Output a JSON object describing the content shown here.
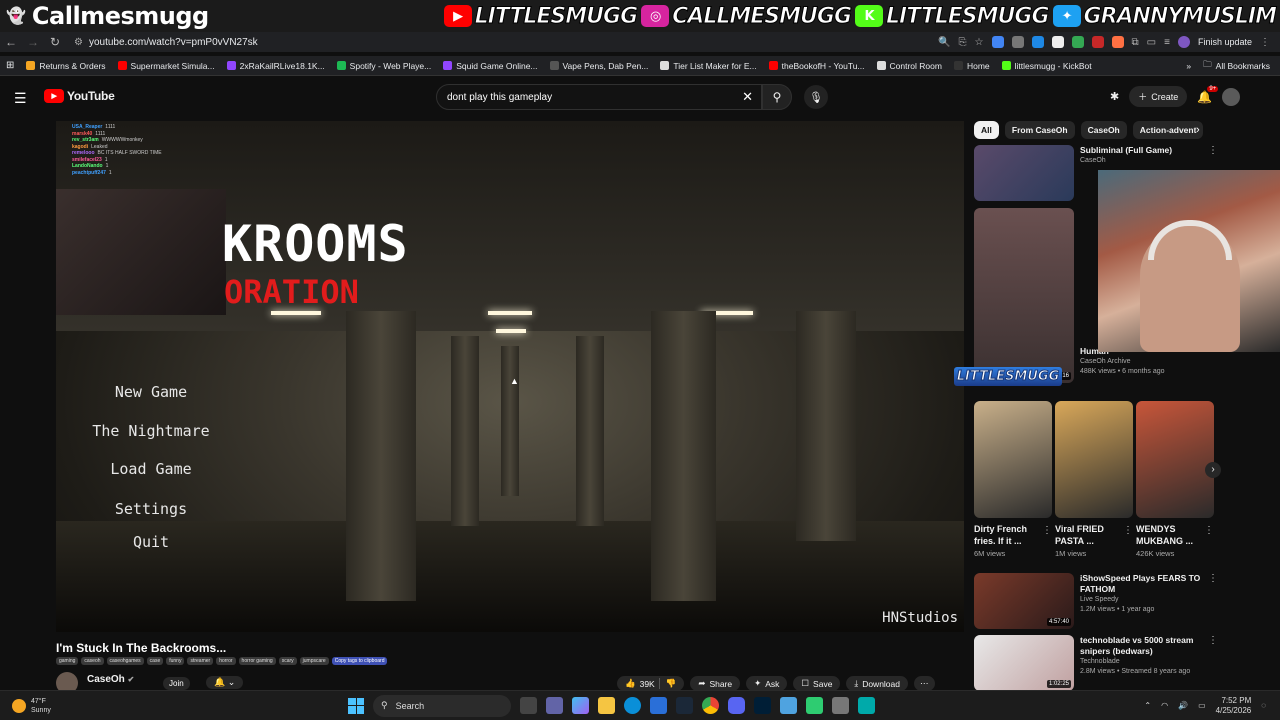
{
  "overlay": {
    "title": "Callmesmugg",
    "socials": [
      {
        "platform": "youtube",
        "handle": "LITTLESMUGG",
        "color": "#ff0000",
        "glyph": "▶"
      },
      {
        "platform": "instagram",
        "handle": "CALLMESMUGG",
        "color": "#d6249f",
        "glyph": "◎"
      },
      {
        "platform": "kick",
        "handle": "LITTLESMUGG",
        "color": "#53fc18",
        "glyph": "K"
      },
      {
        "platform": "twitter",
        "handle": "GRANNYMUSLIM",
        "color": "#1da1f2",
        "glyph": "✦"
      }
    ]
  },
  "browser": {
    "url": "youtube.com/watch?v=pmP0vVN27sk",
    "finish_update": "Finish update",
    "bookmarks": [
      {
        "label": "Returns & Orders",
        "color": "#f5a623"
      },
      {
        "label": "Supermarket Simula...",
        "color": "#ff0000"
      },
      {
        "label": "2xRaKailRLive18.1K...",
        "color": "#9146ff"
      },
      {
        "label": "Spotify - Web Playe...",
        "color": "#1db954"
      },
      {
        "label": "Squid Game Online...",
        "color": "#9146ff"
      },
      {
        "label": "Vape Pens, Dab Pen...",
        "color": "#555555"
      },
      {
        "label": "Tier List Maker for E...",
        "color": "#dddddd"
      },
      {
        "label": "theBookofH - YouTu...",
        "color": "#ff0000"
      },
      {
        "label": "Control Room",
        "color": "#dddddd"
      },
      {
        "label": "Home",
        "color": "#333333"
      },
      {
        "label": "littlesmugg - KickBot",
        "color": "#53fc18"
      }
    ],
    "all_bookmarks": "All Bookmarks"
  },
  "youtube": {
    "logo": "YouTube",
    "search_query": "dont play this gameplay",
    "create_label": "Create",
    "notif_count": "9+"
  },
  "video": {
    "game_title": "KROOMS",
    "game_subtitle": "ORATION",
    "menu": [
      "New Game",
      "The Nightmare",
      "Load Game",
      "Settings",
      "Quit"
    ],
    "studio": "HNStudios",
    "chat": [
      {
        "user": "USA_Reaper",
        "msg": "1111",
        "color": "#3fa0ff"
      },
      {
        "user": "marsk40",
        "msg": "1111",
        "color": "#ff5b5b"
      },
      {
        "user": "rev_str3am",
        "msg": "WWWWWmonkey",
        "color": "#5bff7a"
      },
      {
        "user": "kagodi",
        "msg": "Leaked",
        "color": "#ff9b3f"
      },
      {
        "user": "remelooo",
        "msg": "BC ITS HALF SWORD TIME",
        "color": "#b06bff"
      },
      {
        "user": "smilefacel23",
        "msg": "1",
        "color": "#ff5b9b"
      },
      {
        "user": "LandoNando",
        "msg": "1",
        "color": "#5bff7a"
      },
      {
        "user": "peachtpuff247",
        "msg": "1",
        "color": "#3fa0ff"
      }
    ],
    "title": "I'm Stuck In The Backrooms...",
    "tags": [
      "gaming",
      "caseoh",
      "caseohgames",
      "case",
      "funny",
      "streamer",
      "horror",
      "horror gaming",
      "scary",
      "jumpscare"
    ],
    "copy_tags": "Copy tags to clipboard",
    "channel": "CaseOh",
    "join": "Join",
    "likes": "39K",
    "share": "Share",
    "ask": "Ask",
    "save": "Save",
    "download": "Download"
  },
  "chips": [
    "All",
    "From CaseOh",
    "CaseOh",
    "Action-advent"
  ],
  "recommendations": [
    {
      "title": "Subliminal (Full Game)",
      "channel": "CaseOh",
      "meta": ""
    },
    {
      "title": "Human",
      "channel": "CaseOh Archive",
      "meta": "488K views • 6 months ago",
      "duration": "5:06:16"
    }
  ],
  "overlay_logo": "LITTLESMUGG",
  "shorts": [
    {
      "title": "Dirty French fries. If it ...",
      "views": "6M views",
      "color": "#c9b08a"
    },
    {
      "title": "Viral FRIED PASTA ...",
      "views": "1M views",
      "color": "#d9a85a"
    },
    {
      "title": "WENDYS MUKBANG ...",
      "views": "426K views",
      "color": "#c8563a"
    }
  ],
  "recs_bottom": [
    {
      "title": "iShowSpeed Plays FEARS TO FATHOM",
      "channel": "Live Speedy",
      "meta": "1.2M views • 1 year ago",
      "duration": "4:57:40"
    },
    {
      "title": "technoblade vs 5000 stream snipers (bedwars)",
      "channel": "Technoblade",
      "meta": "2.8M views • Streamed 8 years ago",
      "duration": "1:02:25"
    }
  ],
  "taskbar": {
    "temp": "47°F",
    "condition": "Sunny",
    "search": "Search",
    "time": "7:52 PM",
    "date": "4/25/2026"
  }
}
